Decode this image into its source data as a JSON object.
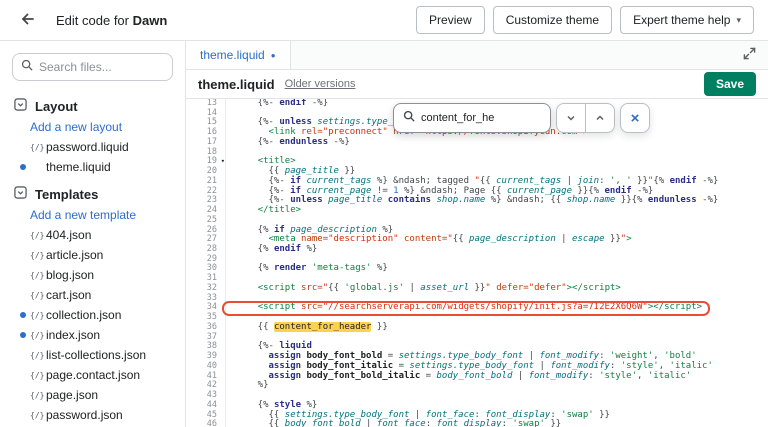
{
  "topbar": {
    "title_prefix": "Edit code for ",
    "title_theme": "Dawn",
    "preview_label": "Preview",
    "customize_label": "Customize theme",
    "expert_label": "Expert theme help",
    "caret": "▾"
  },
  "sidebar": {
    "search_placeholder": "Search files...",
    "layout_section": {
      "label": "Layout",
      "add_link": "Add a new layout",
      "files": [
        {
          "icon": "{/}",
          "name": "password.liquid",
          "dot": false
        },
        {
          "icon": "",
          "name": "theme.liquid",
          "dot": true
        }
      ]
    },
    "templates_section": {
      "label": "Templates",
      "add_link": "Add a new template",
      "files": [
        {
          "icon": "{/}",
          "name": "404.json",
          "dot": false
        },
        {
          "icon": "{/}",
          "name": "article.json",
          "dot": false
        },
        {
          "icon": "{/}",
          "name": "blog.json",
          "dot": false
        },
        {
          "icon": "{/}",
          "name": "cart.json",
          "dot": false
        },
        {
          "icon": "{/}",
          "name": "collection.json",
          "dot": true
        },
        {
          "icon": "{/}",
          "name": "index.json",
          "dot": true
        },
        {
          "icon": "{/}",
          "name": "list-collections.json",
          "dot": false
        },
        {
          "icon": "{/}",
          "name": "page.contact.json",
          "dot": false
        },
        {
          "icon": "{/}",
          "name": "page.json",
          "dot": false
        },
        {
          "icon": "{/}",
          "name": "password.json",
          "dot": false
        }
      ]
    }
  },
  "editor": {
    "tab": {
      "label": "theme.liquid",
      "modified_dot": "●"
    },
    "file_title": "theme.liquid",
    "older_versions_label": "Older versions",
    "save_label": "Save",
    "search_box": {
      "query": "content_for_he",
      "close_glyph": "×"
    },
    "annotation": {
      "line": 34,
      "color": "#ec4c33"
    },
    "match_color": "#ffd24d",
    "first_line": 13,
    "lines": [
      {
        "t": [
          [
            "p",
            "    {%- "
          ],
          [
            "k",
            "endif"
          ],
          [
            "p",
            " -%}"
          ]
        ]
      },
      {
        "t": []
      },
      {
        "t": [
          [
            "p",
            "    {%- "
          ],
          [
            "k",
            "unless"
          ],
          [
            "p",
            " "
          ],
          [
            "v",
            "settings.type_header_font.system?"
          ],
          [
            "p",
            " -%}"
          ]
        ]
      },
      {
        "t": [
          [
            "p",
            "      "
          ],
          [
            "t",
            "<link"
          ],
          [
            "p",
            " "
          ],
          [
            "a",
            "rel="
          ],
          [
            "sh",
            "\"preconnect\""
          ],
          [
            "p",
            " "
          ],
          [
            "a",
            "href="
          ],
          [
            "sh",
            "\"https://fonts.shopifycdn.com\""
          ],
          [
            "t",
            ">"
          ]
        ]
      },
      {
        "t": [
          [
            "p",
            "    {%- "
          ],
          [
            "k",
            "endunless"
          ],
          [
            "p",
            " -%}"
          ]
        ]
      },
      {
        "t": []
      },
      {
        "fold": true,
        "t": [
          [
            "p",
            "    "
          ],
          [
            "t",
            "<title>"
          ]
        ]
      },
      {
        "t": [
          [
            "p",
            "      {{ "
          ],
          [
            "v",
            "page_title"
          ],
          [
            "p",
            " }}"
          ]
        ]
      },
      {
        "t": [
          [
            "p",
            "      {%- "
          ],
          [
            "k",
            "if"
          ],
          [
            "p",
            " "
          ],
          [
            "v",
            "current_tags"
          ],
          [
            "p",
            " %} &ndash; tagged "
          ],
          [
            "sh",
            "\""
          ],
          [
            "p",
            "{{ "
          ],
          [
            "v",
            "current_tags"
          ],
          [
            "p",
            " | "
          ],
          [
            "v",
            "join"
          ],
          [
            "p",
            ": "
          ],
          [
            "s",
            "', '"
          ],
          [
            "p",
            " }}"
          ],
          [
            "sh",
            "\""
          ],
          [
            "p",
            "{% "
          ],
          [
            "k",
            "endif"
          ],
          [
            "p",
            " -%}"
          ]
        ]
      },
      {
        "t": [
          [
            "p",
            "      {%- "
          ],
          [
            "k",
            "if"
          ],
          [
            "p",
            " "
          ],
          [
            "v",
            "current_page"
          ],
          [
            "p",
            " != "
          ],
          [
            "n",
            "1"
          ],
          [
            "p",
            " %} &ndash; Page {{ "
          ],
          [
            "v",
            "current_page"
          ],
          [
            "p",
            " }}{% "
          ],
          [
            "k",
            "endif"
          ],
          [
            "p",
            " -%}"
          ]
        ]
      },
      {
        "t": [
          [
            "p",
            "      {%- "
          ],
          [
            "k",
            "unless"
          ],
          [
            "p",
            " "
          ],
          [
            "v",
            "page_title"
          ],
          [
            "p",
            " "
          ],
          [
            "k",
            "contains"
          ],
          [
            "p",
            " "
          ],
          [
            "v",
            "shop.name"
          ],
          [
            "p",
            " %} &ndash; {{ "
          ],
          [
            "v",
            "shop.name"
          ],
          [
            "p",
            " }}{% "
          ],
          [
            "k",
            "endunless"
          ],
          [
            "p",
            " -%}"
          ]
        ]
      },
      {
        "t": [
          [
            "p",
            "    "
          ],
          [
            "t",
            "</title>"
          ]
        ]
      },
      {
        "t": []
      },
      {
        "t": [
          [
            "p",
            "    {% "
          ],
          [
            "k",
            "if"
          ],
          [
            "p",
            " "
          ],
          [
            "v",
            "page_description"
          ],
          [
            "p",
            " %}"
          ]
        ]
      },
      {
        "t": [
          [
            "p",
            "      "
          ],
          [
            "t",
            "<meta"
          ],
          [
            "p",
            " "
          ],
          [
            "a",
            "name="
          ],
          [
            "sh",
            "\"description\""
          ],
          [
            "p",
            " "
          ],
          [
            "a",
            "content="
          ],
          [
            "sh",
            "\""
          ],
          [
            "p",
            "{{ "
          ],
          [
            "v",
            "page_description"
          ],
          [
            "p",
            " | "
          ],
          [
            "v",
            "escape"
          ],
          [
            "p",
            " }}"
          ],
          [
            "sh",
            "\""
          ],
          [
            "t",
            ">"
          ]
        ]
      },
      {
        "t": [
          [
            "p",
            "    {% "
          ],
          [
            "k",
            "endif"
          ],
          [
            "p",
            " %}"
          ]
        ]
      },
      {
        "t": []
      },
      {
        "t": [
          [
            "p",
            "    {% "
          ],
          [
            "k",
            "render"
          ],
          [
            "p",
            " "
          ],
          [
            "s",
            "'meta-tags'"
          ],
          [
            "p",
            " %}"
          ]
        ]
      },
      {
        "t": []
      },
      {
        "t": [
          [
            "p",
            "    "
          ],
          [
            "t",
            "<script"
          ],
          [
            "p",
            " "
          ],
          [
            "a",
            "src="
          ],
          [
            "sh",
            "\""
          ],
          [
            "p",
            "{{ "
          ],
          [
            "s",
            "'global.js'"
          ],
          [
            "p",
            " | "
          ],
          [
            "v",
            "asset_url"
          ],
          [
            "p",
            " }}"
          ],
          [
            "sh",
            "\""
          ],
          [
            "p",
            " "
          ],
          [
            "a",
            "defer="
          ],
          [
            "sh",
            "\"defer\""
          ],
          [
            "t",
            "></script>"
          ]
        ]
      },
      {
        "t": []
      },
      {
        "t": [
          [
            "p",
            "    "
          ],
          [
            "t",
            "<script"
          ],
          [
            "p",
            " "
          ],
          [
            "a",
            "src="
          ],
          [
            "sh",
            "\"//searchserverapi.com/widgets/shopify/init.js?a=7I2E2X6Q6W\""
          ],
          [
            "t",
            "></script>"
          ]
        ]
      },
      {
        "t": []
      },
      {
        "t": [
          [
            "p",
            "    {{ "
          ],
          [
            "hl",
            "content_for_header"
          ],
          [
            "p",
            " }}"
          ]
        ]
      },
      {
        "t": []
      },
      {
        "t": [
          [
            "p",
            "    {%- "
          ],
          [
            "k",
            "liquid"
          ]
        ]
      },
      {
        "t": [
          [
            "p",
            "      "
          ],
          [
            "k",
            "assign"
          ],
          [
            "p",
            " "
          ],
          [
            "d",
            "body_font_bold"
          ],
          [
            "p",
            " = "
          ],
          [
            "v",
            "settings.type_body_font"
          ],
          [
            "p",
            " | "
          ],
          [
            "v",
            "font_modify"
          ],
          [
            "p",
            ": "
          ],
          [
            "s",
            "'weight'"
          ],
          [
            "p",
            ", "
          ],
          [
            "s",
            "'bold'"
          ]
        ]
      },
      {
        "t": [
          [
            "p",
            "      "
          ],
          [
            "k",
            "assign"
          ],
          [
            "p",
            " "
          ],
          [
            "d",
            "body_font_italic"
          ],
          [
            "p",
            " = "
          ],
          [
            "v",
            "settings.type_body_font"
          ],
          [
            "p",
            " | "
          ],
          [
            "v",
            "font_modify"
          ],
          [
            "p",
            ": "
          ],
          [
            "s",
            "'style'"
          ],
          [
            "p",
            ", "
          ],
          [
            "s",
            "'italic'"
          ]
        ]
      },
      {
        "t": [
          [
            "p",
            "      "
          ],
          [
            "k",
            "assign"
          ],
          [
            "p",
            " "
          ],
          [
            "d",
            "body_font_bold_italic"
          ],
          [
            "p",
            " = "
          ],
          [
            "v",
            "body_font_bold"
          ],
          [
            "p",
            " | "
          ],
          [
            "v",
            "font_modify"
          ],
          [
            "p",
            ": "
          ],
          [
            "s",
            "'style'"
          ],
          [
            "p",
            ", "
          ],
          [
            "s",
            "'italic'"
          ]
        ]
      },
      {
        "t": [
          [
            "p",
            "    %}"
          ]
        ]
      },
      {
        "t": []
      },
      {
        "t": [
          [
            "p",
            "    {% "
          ],
          [
            "k",
            "style"
          ],
          [
            "p",
            " %}"
          ]
        ]
      },
      {
        "t": [
          [
            "p",
            "      {{ "
          ],
          [
            "v",
            "settings.type_body_font"
          ],
          [
            "p",
            " | "
          ],
          [
            "v",
            "font_face"
          ],
          [
            "p",
            ": "
          ],
          [
            "v",
            "font_display"
          ],
          [
            "p",
            ": "
          ],
          [
            "s",
            "'swap'"
          ],
          [
            "p",
            " }}"
          ]
        ]
      },
      {
        "t": [
          [
            "p",
            "      {{ "
          ],
          [
            "v",
            "body_font_bold"
          ],
          [
            "p",
            " | "
          ],
          [
            "v",
            "font_face"
          ],
          [
            "p",
            ": "
          ],
          [
            "v",
            "font_display"
          ],
          [
            "p",
            ": "
          ],
          [
            "s",
            "'swap'"
          ],
          [
            "p",
            " }}"
          ]
        ]
      }
    ]
  }
}
